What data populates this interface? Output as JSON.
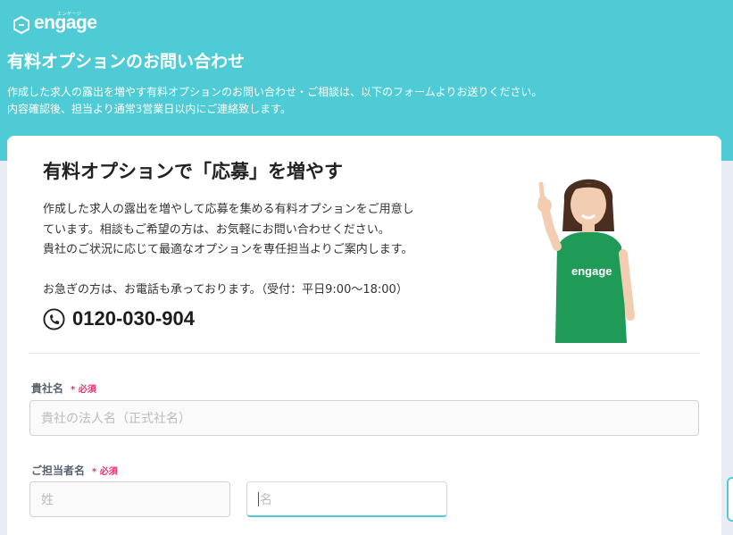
{
  "brand": {
    "name": "engage",
    "kana": "エンゲージ"
  },
  "header": {
    "title": "有料オプションのお問い合わせ",
    "description_line1": "作成した求人の露出を増やす有料オプションのお問い合わせ・ご相談は、以下のフォームよりお送りください。",
    "description_line2": "内容確認後、担当より通常3営業日以内にご連絡致します。"
  },
  "card": {
    "title": "有料オプションで「応募」を増やす",
    "text_line1": "作成した求人の露出を増やして応募を集める有料オプションをご用意し",
    "text_line2": "ています。相談もご希望の方は、お気軽にお問い合わせください。",
    "text_line3": "貴社のご状況に応じて最適なオプションを専任担当よりご案内します。",
    "note": "お急ぎの方は、お電話も承っております。（受付：平日9:00〜18:00）",
    "phone": "0120-030-904",
    "shirt_text": "engage"
  },
  "form": {
    "company": {
      "label": "貴社名",
      "required": "* 必須",
      "placeholder": "貴社の法人名（正式社名）"
    },
    "contact": {
      "label": "ご担当者名",
      "required": "* 必須",
      "last_placeholder": "姓",
      "first_placeholder": "名"
    }
  },
  "colors": {
    "accent": "#4ecbd4",
    "required": "#e8336f",
    "shirt": "#1f9b57"
  }
}
